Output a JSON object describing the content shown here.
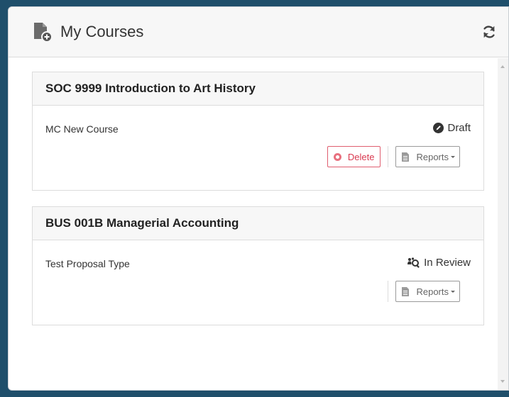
{
  "header": {
    "title": "My Courses",
    "icon": "file-add-icon",
    "refresh_icon": "refresh-icon"
  },
  "courses": [
    {
      "title": "SOC 9999 Introduction to Art History",
      "type": "MC New Course",
      "status": "Draft",
      "status_icon": "pencil-circle-icon",
      "actions": {
        "delete": "Delete",
        "reports": "Reports"
      }
    },
    {
      "title": "BUS 001B Managerial Accounting",
      "type": "Test Proposal Type",
      "status": "In Review",
      "status_icon": "users-search-icon",
      "actions": {
        "reports": "Reports"
      }
    }
  ],
  "colors": {
    "background": "#1f4f6b",
    "delete": "#d9394f",
    "header_bg": "#f7f7f7"
  }
}
